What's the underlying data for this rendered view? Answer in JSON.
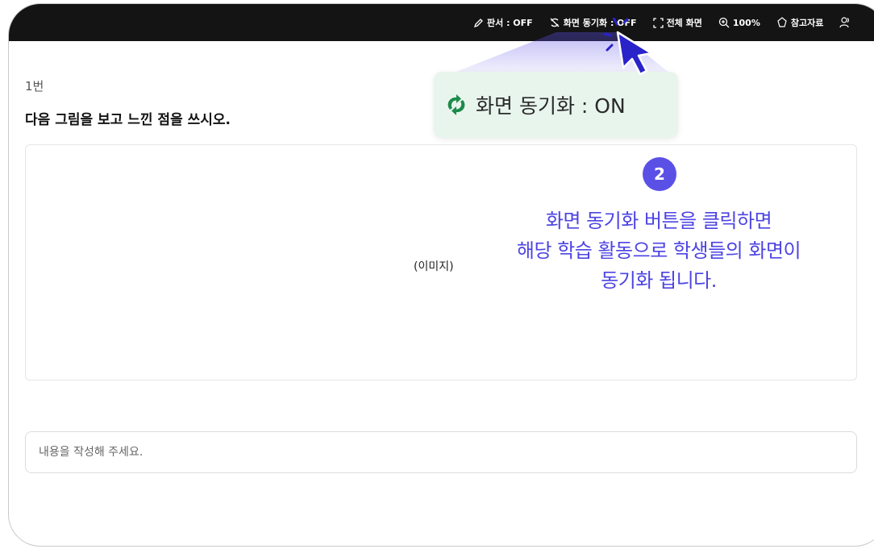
{
  "toolbar": {
    "items": [
      {
        "label": "판서 : OFF",
        "icon": "pen-icon"
      },
      {
        "label": "화면 동기화 : OFF",
        "icon": "sync-off-icon"
      },
      {
        "label": "전체 화면",
        "icon": "fullscreen-icon"
      },
      {
        "label": "100%",
        "icon": "zoom-in-icon"
      },
      {
        "label": "참고자료",
        "icon": "reference-icon"
      }
    ]
  },
  "question": {
    "number": "1번",
    "text": "다음 그림을 보고 느낀 점을 쓰시오.",
    "image_label": "(이미지)"
  },
  "answer": {
    "placeholder": "내용을 작성해 주세요."
  },
  "callout": {
    "text": "화면 동기화 : ON",
    "icon": "sync-icon"
  },
  "step": {
    "number": "2",
    "lines": [
      "화면 동기화 버튼을 클릭하면",
      "해당 학습 활동으로 학생들의 화면이",
      "동기화 됩니다."
    ]
  },
  "colors": {
    "topbar_bg": "#141414",
    "accent_purple": "#5b50e6",
    "callout_bg": "#e8f5ec",
    "sync_green": "#1c8a4a"
  }
}
